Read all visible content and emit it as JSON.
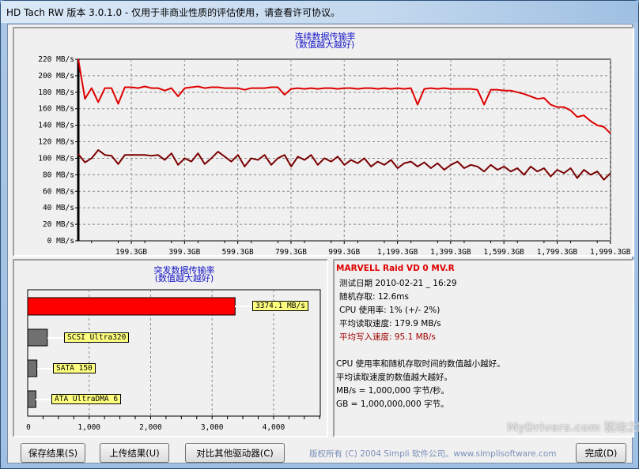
{
  "window": {
    "title": "HD Tach RW 版本 3.0.1.0  - 仅用于非商业性质的评估使用，请查看许可协议。"
  },
  "sequential": {
    "title": "连续数据传输率",
    "subtitle": "(数值越大越好)"
  },
  "burst": {
    "title": "突发数据传输率",
    "subtitle": "(数值越大越好)"
  },
  "info": {
    "drive": "MARVELL Raid VD 0 MV.R",
    "test_date": "测试日期 2010-02-21 _ 16:29",
    "random_access": "随机存取: 12.6ms",
    "cpu": "CPU 使用率: 1% (+/- 2%)",
    "avg_read": "平均读取速度: 179.9 MB/s",
    "avg_write": "平均写入速度: 95.1 MB/s",
    "note1": "CPU 使用率和随机存取时间的数值越小越好。",
    "note2": "平均读取速度的数值越大越好。",
    "note3": "MB/s = 1,000,000 字节/秒。",
    "note4": "GB = 1,000,000,000 字节。"
  },
  "buttons": {
    "save": "保存结果(S)",
    "upload": "上传结果(U)",
    "compare": "对比其他驱动器(C)",
    "done": "完成(D)"
  },
  "copyright": "版权所有 (C) 2004 Simpli 软件公司。www.simplisoftware.com",
  "watermark": "MyDrivers.com 驱动之家",
  "colors": {
    "read": "#e00000",
    "write": "#7a0000",
    "burst_bar": "#ff0000",
    "ref_bar": "#707070",
    "title": "#1515c8"
  },
  "chart_data": [
    {
      "type": "line",
      "title": "连续数据传输率",
      "subtitle": "(数值越大越好)",
      "xlabel": "",
      "ylabel": "",
      "xlim": [
        0,
        2000
      ],
      "ylim": [
        0,
        220
      ],
      "grid": true,
      "y_ticks": [
        0,
        20,
        40,
        60,
        80,
        100,
        120,
        140,
        160,
        180,
        200,
        220
      ],
      "y_tick_labels": [
        "0 MB/s",
        "20 MB/s",
        "40 MB/s",
        "60 MB/s",
        "80 MB/s",
        "100 MB/s",
        "120 MB/s",
        "140 MB/s",
        "160 MB/s",
        "180 MB/s",
        "200 MB/s",
        "220 MB/s"
      ],
      "x_ticks": [
        199.3,
        399.3,
        599.3,
        799.3,
        999.3,
        1199.3,
        1399.3,
        1599.3,
        1799.3,
        1999.3
      ],
      "x_tick_labels": [
        "199.3GB",
        "399.3GB",
        "599.3GB",
        "799.3GB",
        "999.3GB",
        "1,199.3GB",
        "1,399.3GB",
        "1,599.3GB",
        "1,799.3GB",
        "1,999.3GB"
      ],
      "x_step": 25,
      "series": [
        {
          "name": "read",
          "values": [
            220,
            172,
            185,
            168,
            185,
            185,
            166,
            186,
            186,
            185,
            187,
            185,
            185,
            182,
            185,
            175,
            185,
            186,
            187,
            185,
            186,
            186,
            185,
            185,
            185,
            183,
            185,
            185,
            185,
            186,
            186,
            177,
            184,
            185,
            184,
            185,
            184,
            185,
            185,
            184,
            185,
            185,
            184,
            185,
            185,
            184,
            185,
            184,
            185,
            184,
            185,
            165,
            184,
            185,
            184,
            185,
            184,
            184,
            184,
            184,
            183,
            165,
            183,
            183,
            182,
            182,
            180,
            178,
            175,
            172,
            173,
            165,
            162,
            162,
            158,
            150,
            152,
            145,
            140,
            138,
            130
          ]
        },
        {
          "name": "write",
          "values": [
            105,
            95,
            100,
            110,
            104,
            103,
            93,
            104,
            104,
            104,
            104,
            103,
            104,
            98,
            106,
            92,
            100,
            96,
            106,
            93,
            100,
            108,
            102,
            96,
            104,
            90,
            100,
            98,
            104,
            92,
            100,
            104,
            90,
            102,
            98,
            104,
            92,
            100,
            96,
            102,
            92,
            98,
            94,
            100,
            90,
            96,
            92,
            98,
            88,
            94,
            96,
            90,
            95,
            88,
            94,
            86,
            92,
            96,
            88,
            92,
            90,
            84,
            92,
            86,
            90,
            84,
            88,
            80,
            90,
            84,
            88,
            78,
            86,
            82,
            88,
            76,
            86,
            80,
            84,
            74,
            82
          ]
        }
      ]
    },
    {
      "type": "bar",
      "orientation": "horizontal",
      "title": "突发数据传输率",
      "subtitle": "(数值越大越好)",
      "xlim": [
        0,
        4760
      ],
      "x_ticks": [
        0,
        1000,
        2000,
        3000,
        4000
      ],
      "x_tick_labels": [
        "0",
        "1,000",
        "2,000",
        "3,000",
        "4,000"
      ],
      "categories": [
        "3374.1 MB/s",
        "SCSI Ultra320",
        "SATA 150",
        "ATA UltraDMA 6"
      ],
      "values": [
        3374.1,
        320,
        150,
        133
      ]
    }
  ]
}
